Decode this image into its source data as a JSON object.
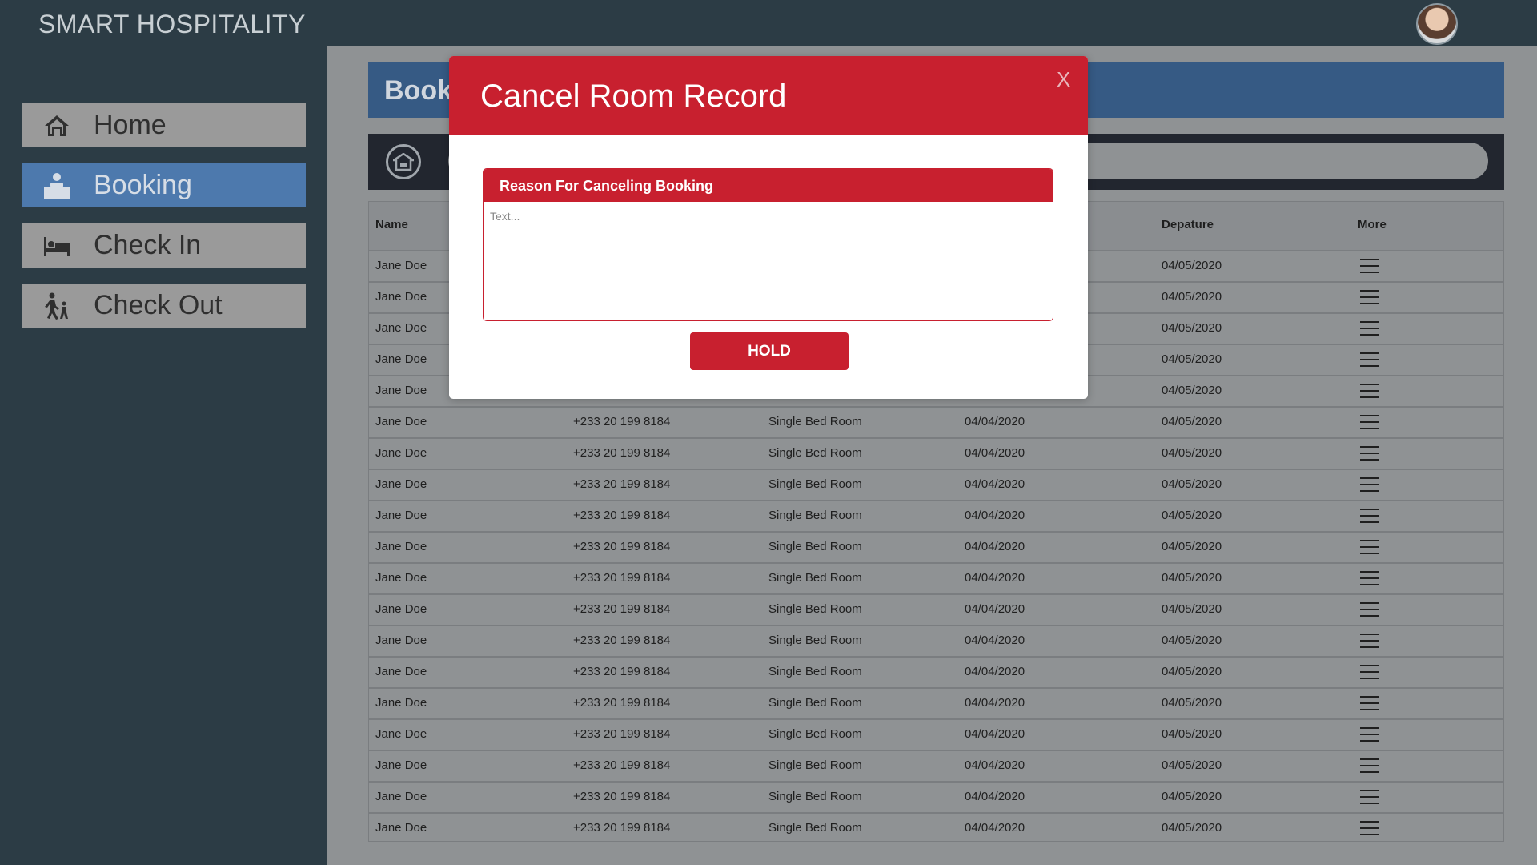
{
  "app": {
    "brand": "SMART HOSPITALITY"
  },
  "sidebar": {
    "items": [
      {
        "label": "Home",
        "icon": "home-icon"
      },
      {
        "label": "Booking",
        "icon": "reception-desk-icon",
        "active": true
      },
      {
        "label": "Check In",
        "icon": "bed-icon"
      },
      {
        "label": "Check Out",
        "icon": "walking-luggage-icon"
      }
    ]
  },
  "main": {
    "header_title": "Book",
    "table": {
      "columns": [
        "Name",
        "",
        "",
        "",
        "Depature",
        "More"
      ],
      "rows": [
        [
          "Jane Doe",
          "",
          "",
          "",
          "04/05/2020"
        ],
        [
          "Jane Doe",
          "",
          "",
          "",
          "04/05/2020"
        ],
        [
          "Jane Doe",
          "",
          "",
          "",
          "04/05/2020"
        ],
        [
          "Jane Doe",
          "",
          "",
          "",
          "04/05/2020"
        ],
        [
          "Jane Doe",
          "",
          "",
          "",
          "04/05/2020"
        ],
        [
          "Jane Doe",
          "+233 20 199 8184",
          "Single Bed Room",
          "04/04/2020",
          "04/05/2020"
        ],
        [
          "Jane Doe",
          "+233 20 199 8184",
          "Single Bed Room",
          "04/04/2020",
          "04/05/2020"
        ],
        [
          "Jane Doe",
          "+233 20 199 8184",
          "Single Bed Room",
          "04/04/2020",
          "04/05/2020"
        ],
        [
          "Jane Doe",
          "+233 20 199 8184",
          "Single Bed Room",
          "04/04/2020",
          "04/05/2020"
        ],
        [
          "Jane Doe",
          "+233 20 199 8184",
          "Single Bed Room",
          "04/04/2020",
          "04/05/2020"
        ],
        [
          "Jane Doe",
          "+233 20 199 8184",
          "Single Bed Room",
          "04/04/2020",
          "04/05/2020"
        ],
        [
          "Jane Doe",
          "+233 20 199 8184",
          "Single Bed Room",
          "04/04/2020",
          "04/05/2020"
        ],
        [
          "Jane Doe",
          "+233 20 199 8184",
          "Single Bed Room",
          "04/04/2020",
          "04/05/2020"
        ],
        [
          "Jane Doe",
          "+233 20 199 8184",
          "Single Bed Room",
          "04/04/2020",
          "04/05/2020"
        ],
        [
          "Jane Doe",
          "+233 20 199 8184",
          "Single Bed Room",
          "04/04/2020",
          "04/05/2020"
        ],
        [
          "Jane Doe",
          "+233 20 199 8184",
          "Single Bed Room",
          "04/04/2020",
          "04/05/2020"
        ],
        [
          "Jane Doe",
          "+233 20 199 8184",
          "Single Bed Room",
          "04/04/2020",
          "04/05/2020"
        ],
        [
          "Jane Doe",
          "+233 20 199 8184",
          "Single Bed Room",
          "04/04/2020",
          "04/05/2020"
        ],
        [
          "Jane Doe",
          "+233 20 199 8184",
          "Single Bed Room",
          "04/04/2020",
          "04/05/2020"
        ]
      ]
    }
  },
  "modal": {
    "title": "Cancel Room Record",
    "close_label": "X",
    "field_label": "Reason For Canceling Booking",
    "textarea_placeholder": "Text...",
    "textarea_value": "",
    "hold_label": "HOLD"
  },
  "colors": {
    "modal_red": "#c8202f",
    "sidebar_active": "#4d79ad",
    "header_blue": "#365a84",
    "background_dark": "#2c3c45"
  }
}
